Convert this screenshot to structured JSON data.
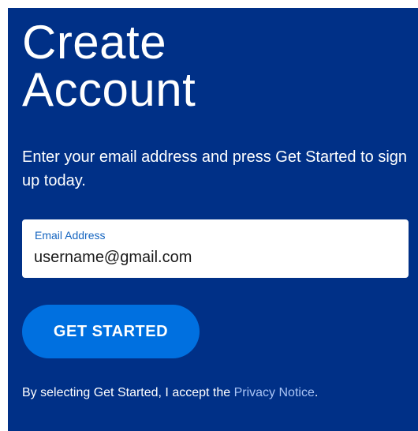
{
  "page": {
    "title_line1": "Create",
    "title_line2": "Account",
    "subtitle": "Enter your email address and press Get Started to sign up today."
  },
  "form": {
    "email_label": "Email Address",
    "email_value": "username@gmail.com",
    "submit_label": "GET STARTED"
  },
  "footer": {
    "consent_prefix": "By selecting Get Started, I accept the ",
    "privacy_link": "Privacy Notice",
    "consent_suffix": "."
  },
  "colors": {
    "panel_bg": "#003087",
    "button_bg": "#0070e0",
    "label_blue": "#1565c0",
    "link_blue": "#a9c4f5"
  }
}
